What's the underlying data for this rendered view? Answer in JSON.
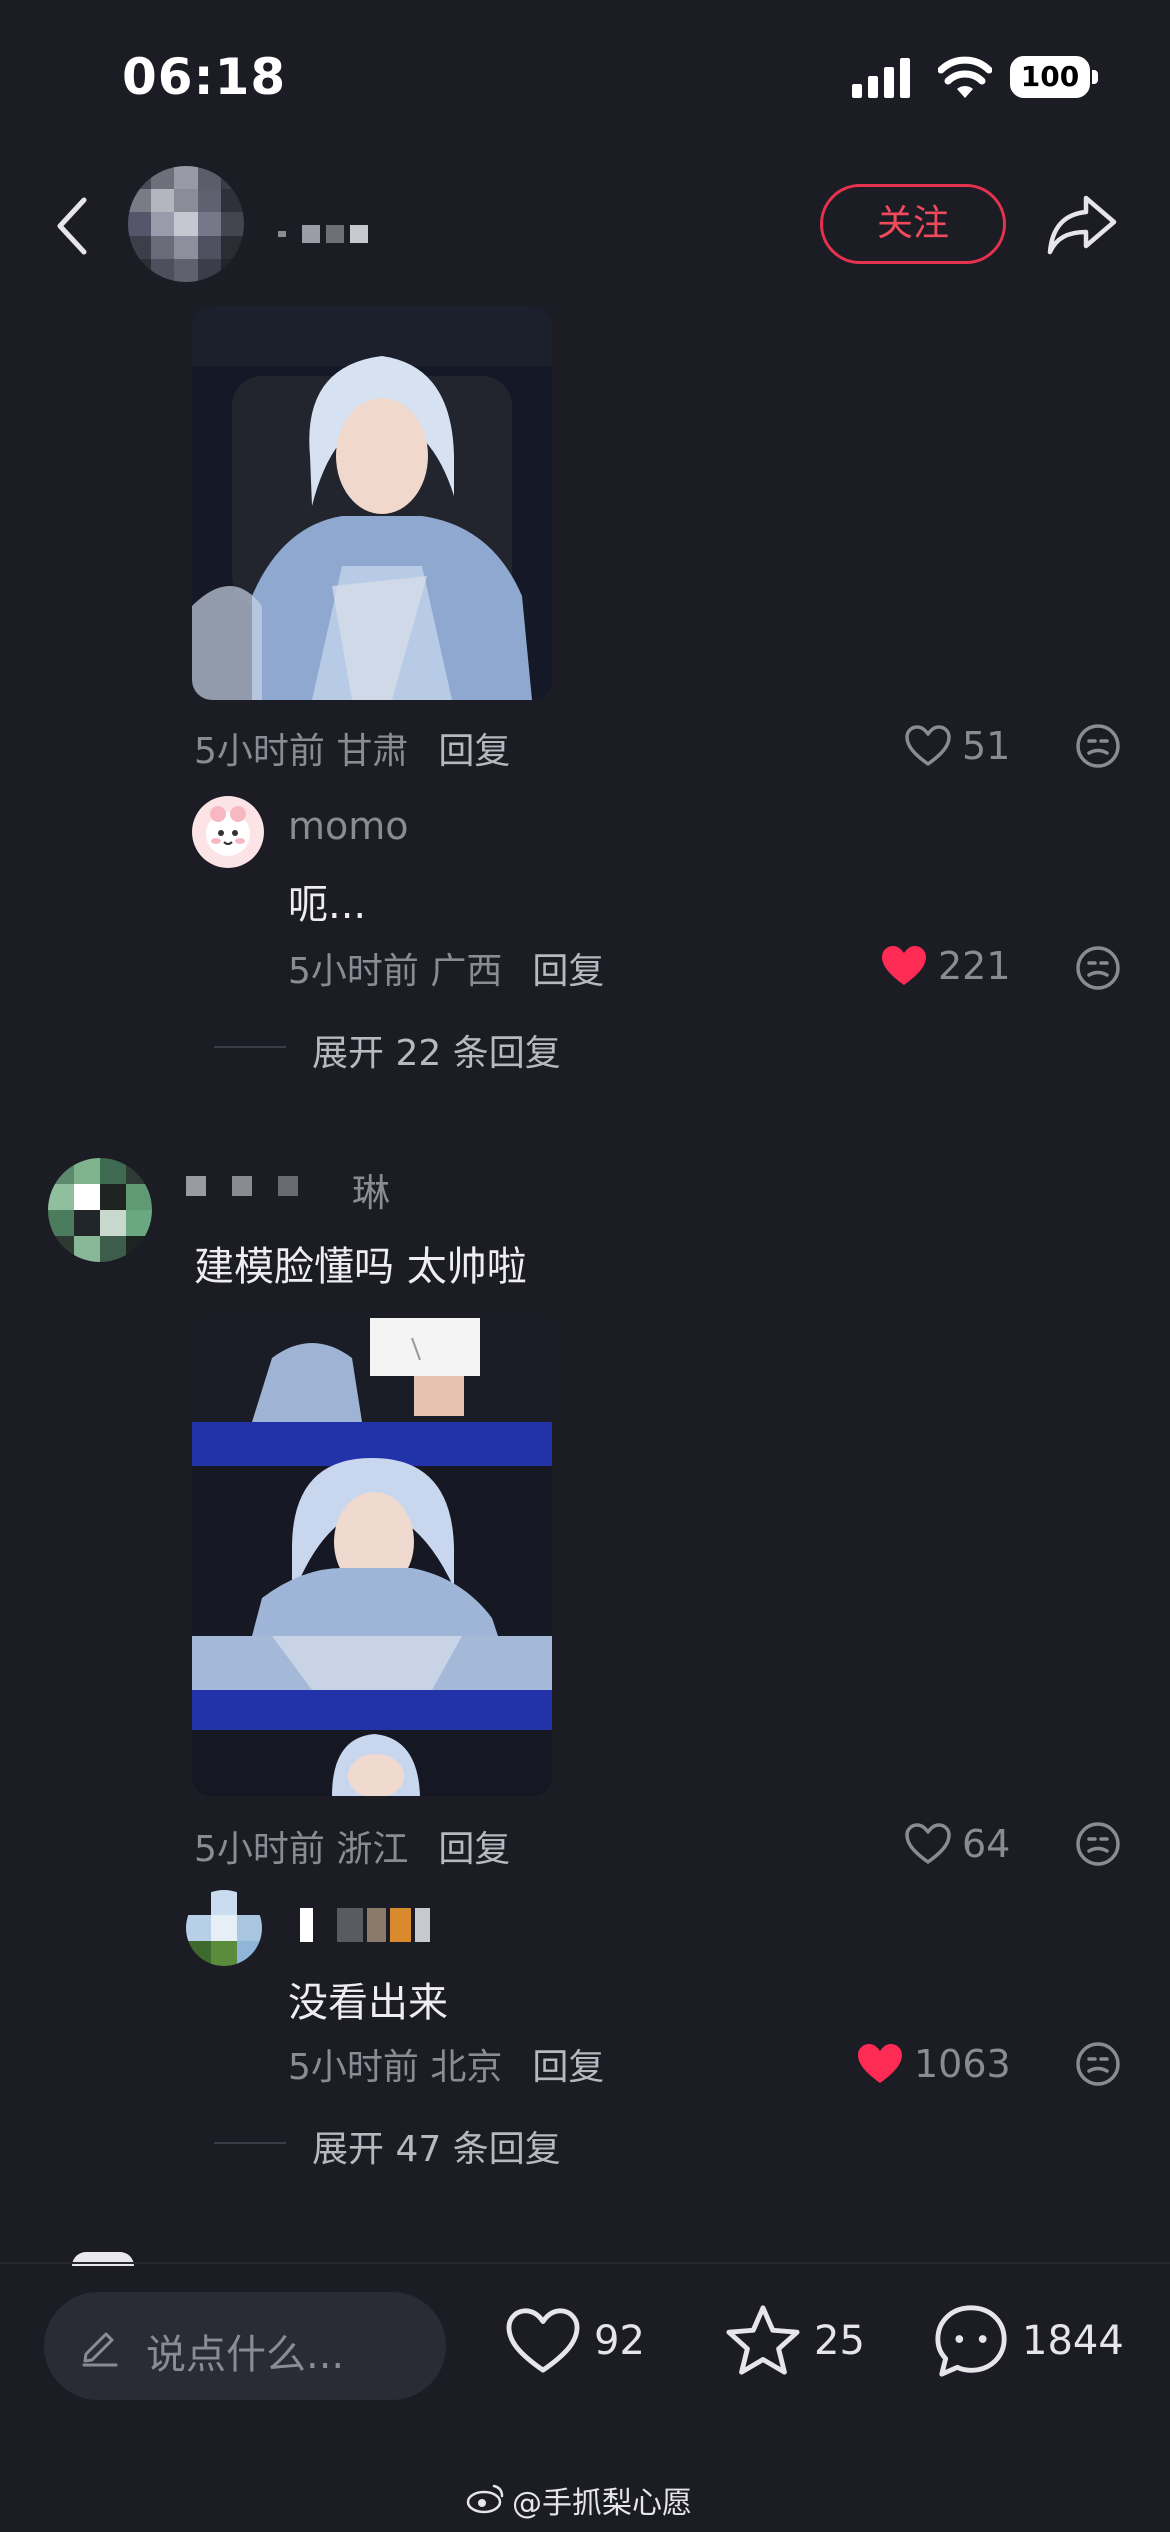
{
  "status_bar": {
    "time": "06:18",
    "battery": "100"
  },
  "header": {
    "follow_label": "关注"
  },
  "comments": [
    {
      "meta_time_loc": "5小时前 甘肃",
      "reply_label": "回复",
      "likes": "51",
      "sub_reply": {
        "username": "momo",
        "text": "呃...",
        "meta_time_loc": "5小时前 广西",
        "reply_label": "回复",
        "likes": "221"
      },
      "expand_label": "展开 22 条回复"
    },
    {
      "username_visible": "琳",
      "text": "建模脸懂吗 太帅啦",
      "meta_time_loc": "5小时前 浙江",
      "reply_label": "回复",
      "likes": "64",
      "sub_reply": {
        "text": "没看出来",
        "meta_time_loc": "5小时前 北京",
        "reply_label": "回复",
        "likes": "1063"
      },
      "expand_label": "展开 47 条回复"
    }
  ],
  "bottom_bar": {
    "input_placeholder": "说点什么...",
    "like_count": "92",
    "favorite_count": "25",
    "comment_count": "1844"
  },
  "watermark": "@手抓梨心愿",
  "colors": {
    "background": "#1b1c24",
    "accent": "#e5334d",
    "liked_heart": "#fe2c55"
  }
}
